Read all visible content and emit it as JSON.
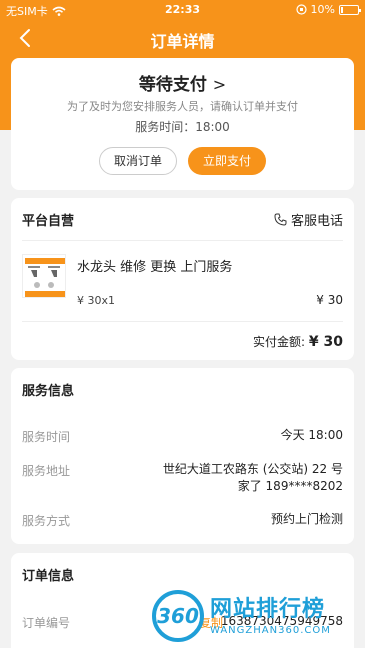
{
  "status_bar": {
    "carrier": "无SIM卡",
    "time": "22:33",
    "battery": "10%",
    "battery_level": 0.1
  },
  "nav": {
    "title": "订单详情"
  },
  "status_card": {
    "title": "等待支付",
    "subtitle": "为了及时为您安排服务人员，请确认订单并支付",
    "service_time": "服务时间：18:00",
    "cancel_label": "取消订单",
    "pay_label": "立即支付"
  },
  "order": {
    "shop": "平台自营",
    "customer_service": "客服电话",
    "product_name": "水龙头 维修 更换 上门服务",
    "unit_price": "¥ 30x1",
    "total": "¥ 30",
    "paid_label": "实付金额: ",
    "paid_amount": "¥ 30"
  },
  "service_info": {
    "title": "服务信息",
    "rows": [
      {
        "label": "服务时间",
        "value": "今天 18:00"
      },
      {
        "label": "服务地址",
        "value": "世纪大道工农路东 (公交站) 22 号",
        "value2": "家了 189****8202"
      },
      {
        "label": "服务方式",
        "value": "预约上门检测"
      }
    ]
  },
  "order_info": {
    "title": "订单信息",
    "rows": [
      {
        "label": "订单编号",
        "copy": "复制",
        "value": "1638730475949758"
      }
    ]
  },
  "watermark": {
    "logo": "360",
    "text": "网站排行榜",
    "domain": "WANGZHAN360.COM"
  },
  "colors": {
    "accent": "#f7931a",
    "watermark": "#1f9fd8"
  }
}
